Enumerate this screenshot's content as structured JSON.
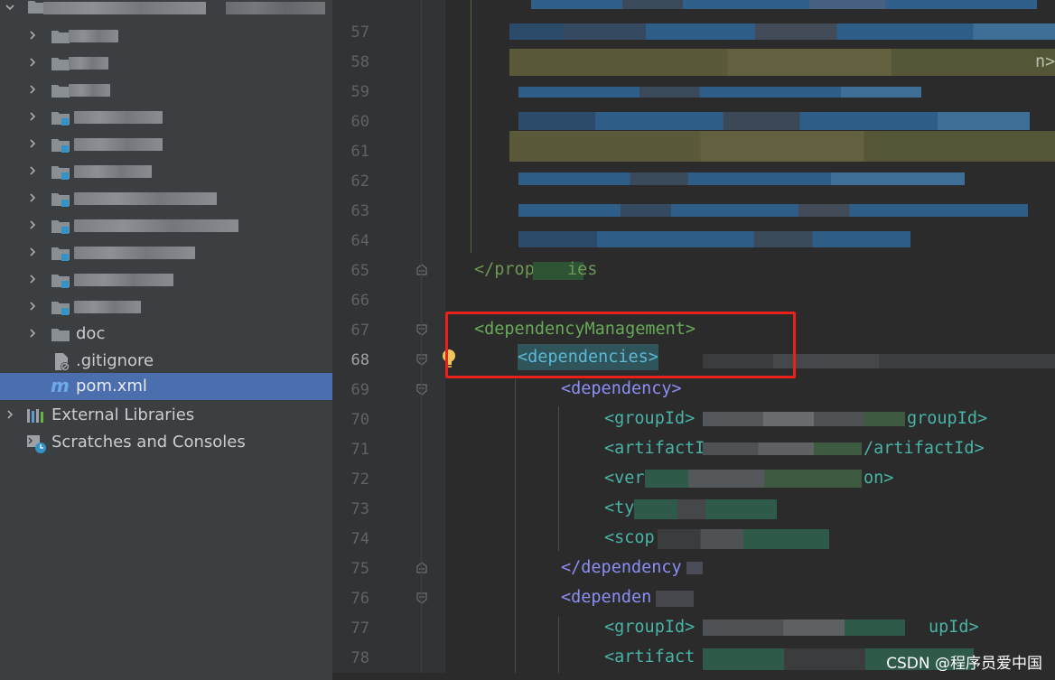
{
  "project_tree": {
    "items": [
      {
        "label": "doc",
        "icon": "folder-icon"
      },
      {
        "label": ".gitignore",
        "icon": "gitignore-file-icon"
      },
      {
        "label": "pom.xml",
        "icon": "maven-file-icon",
        "selected": true
      },
      {
        "label": "External Libraries",
        "icon": "library-icon"
      },
      {
        "label": "Scratches and Consoles",
        "icon": "scratches-icon"
      }
    ]
  },
  "editor": {
    "line_numbers": [
      "57",
      "58",
      "59",
      "60",
      "61",
      "62",
      "63",
      "64",
      "65",
      "66",
      "67",
      "68",
      "69",
      "70",
      "71",
      "72",
      "73",
      "74",
      "75",
      "76",
      "77",
      "78"
    ],
    "current_line": "68",
    "code": {
      "l65": "</prop",
      "l65b": "ies",
      "l67": "<dependencyManagement>",
      "l68": "<dependencies>",
      "l69": "<dependency>",
      "l70a": "<groupId>",
      "l70b": "groupId>",
      "l71a": "<artifactI",
      "l71b": "/artifactId>",
      "l72a": "<ver",
      "l72b": "on>",
      "l73": "<ty",
      "l74": "<scop",
      "l75": "</dependency",
      "l76": "<dependen",
      "l77a": "<groupId>",
      "l77b": "upId>",
      "l78": "<artifact"
    }
  },
  "colors": {
    "sidebar_bg": "#3c3f41",
    "editor_bg": "#2b2b2b",
    "selection": "#4b6eaf",
    "highlight_box": "#e8221b",
    "tag_green": "#6a9955",
    "tag_purple": "#8b8ef5",
    "tag_teal": "#48b3a6"
  },
  "watermark": "CSDN @程序员爱中国"
}
